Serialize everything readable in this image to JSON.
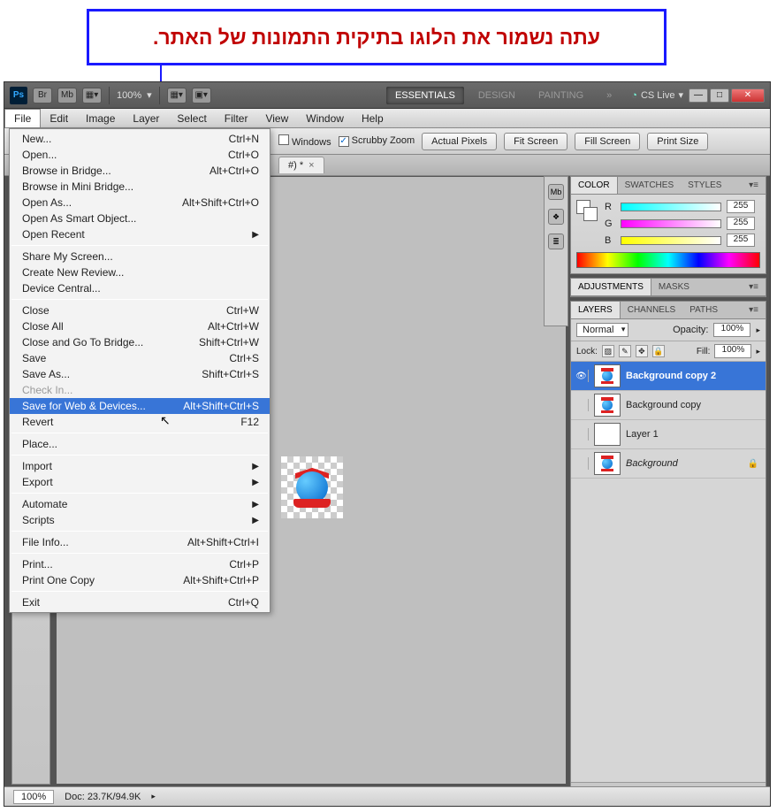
{
  "callout": {
    "text": "עתה נשמור את הלוגו בתיקית התמונות של האתר."
  },
  "toolbar": {
    "zoom": "100%",
    "workspaces": [
      "ESSENTIALS",
      "DESIGN",
      "PAINTING"
    ],
    "more": "»",
    "cslive": "CS Live"
  },
  "menus": [
    "File",
    "Edit",
    "Image",
    "Layer",
    "Select",
    "Filter",
    "View",
    "Window",
    "Help"
  ],
  "options": {
    "windows_label": "Windows",
    "scrubby": "Scrubby Zoom",
    "buttons": [
      "Actual Pixels",
      "Fit Screen",
      "Fill Screen",
      "Print Size"
    ]
  },
  "doc_tab": {
    "name": "#) *",
    "close": "×"
  },
  "file_menu": [
    {
      "label": "New...",
      "shortcut": "Ctrl+N"
    },
    {
      "label": "Open...",
      "shortcut": "Ctrl+O"
    },
    {
      "label": "Browse in Bridge...",
      "shortcut": "Alt+Ctrl+O"
    },
    {
      "label": "Browse in Mini Bridge..."
    },
    {
      "label": "Open As...",
      "shortcut": "Alt+Shift+Ctrl+O"
    },
    {
      "label": "Open As Smart Object..."
    },
    {
      "label": "Open Recent",
      "submenu": true
    },
    {
      "sep": true
    },
    {
      "label": "Share My Screen..."
    },
    {
      "label": "Create New Review..."
    },
    {
      "label": "Device Central..."
    },
    {
      "sep": true
    },
    {
      "label": "Close",
      "shortcut": "Ctrl+W"
    },
    {
      "label": "Close All",
      "shortcut": "Alt+Ctrl+W"
    },
    {
      "label": "Close and Go To Bridge...",
      "shortcut": "Shift+Ctrl+W"
    },
    {
      "label": "Save",
      "shortcut": "Ctrl+S"
    },
    {
      "label": "Save As...",
      "shortcut": "Shift+Ctrl+S"
    },
    {
      "label": "Check In...",
      "disabled": true
    },
    {
      "label": "Save for Web & Devices...",
      "shortcut": "Alt+Shift+Ctrl+S",
      "highlight": true
    },
    {
      "label": "Revert",
      "shortcut": "F12"
    },
    {
      "sep": true
    },
    {
      "label": "Place..."
    },
    {
      "sep": true
    },
    {
      "label": "Import",
      "submenu": true
    },
    {
      "label": "Export",
      "submenu": true
    },
    {
      "sep": true
    },
    {
      "label": "Automate",
      "submenu": true
    },
    {
      "label": "Scripts",
      "submenu": true
    },
    {
      "sep": true
    },
    {
      "label": "File Info...",
      "shortcut": "Alt+Shift+Ctrl+I"
    },
    {
      "sep": true
    },
    {
      "label": "Print...",
      "shortcut": "Ctrl+P"
    },
    {
      "label": "Print One Copy",
      "shortcut": "Alt+Shift+Ctrl+P"
    },
    {
      "sep": true
    },
    {
      "label": "Exit",
      "shortcut": "Ctrl+Q"
    }
  ],
  "color_panel": {
    "tabs": [
      "COLOR",
      "SWATCHES",
      "STYLES"
    ],
    "r": "255",
    "g": "255",
    "b": "255"
  },
  "adjustments_panel": {
    "tabs": [
      "ADJUSTMENTS",
      "MASKS"
    ]
  },
  "layers_panel": {
    "tabs": [
      "LAYERS",
      "CHANNELS",
      "PATHS"
    ],
    "blend": "Normal",
    "opacity_label": "Opacity:",
    "opacity": "100%",
    "lock_label": "Lock:",
    "fill_label": "Fill:",
    "fill": "100%",
    "layers": [
      {
        "name": "Background copy 2",
        "selected": true,
        "visible": true,
        "bold": true,
        "italic": false,
        "thumb": "logo"
      },
      {
        "name": "Background copy",
        "visible": false,
        "thumb": "logo"
      },
      {
        "name": "Layer 1",
        "visible": false,
        "thumb": "white"
      },
      {
        "name": "Background",
        "visible": false,
        "italic": true,
        "locked": true,
        "thumb": "logo"
      }
    ]
  },
  "status": {
    "zoom": "100%",
    "doc": "Doc: 23.7K/94.9K"
  }
}
